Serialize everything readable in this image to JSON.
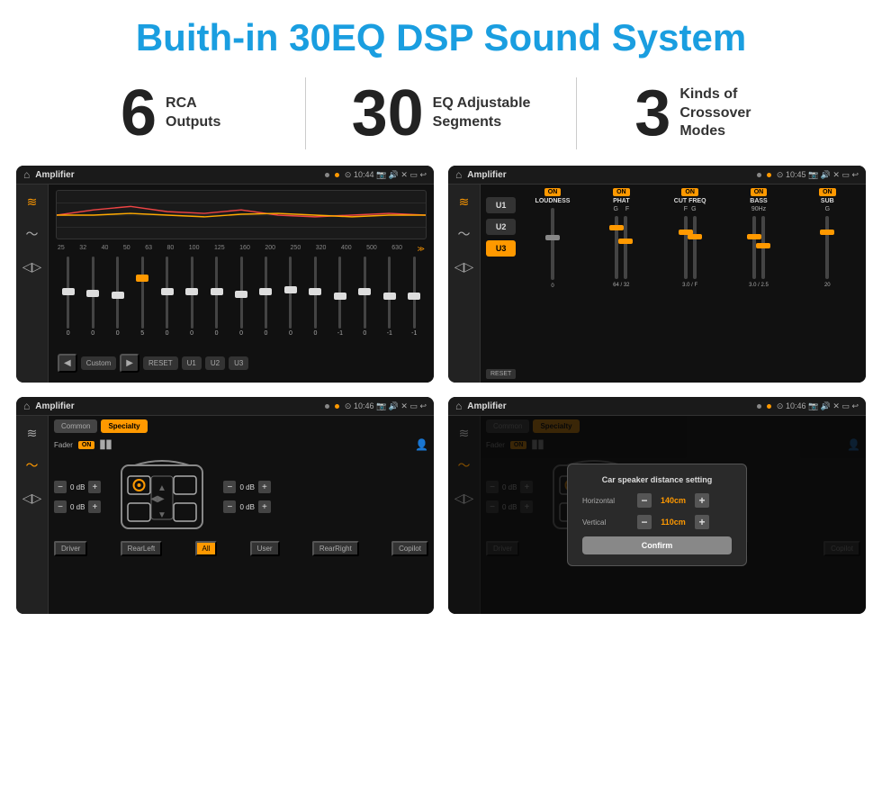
{
  "header": {
    "title": "Buith-in 30EQ DSP Sound System"
  },
  "stats": [
    {
      "number": "6",
      "label": "RCA\nOutputs"
    },
    {
      "number": "30",
      "label": "EQ Adjustable\nSegments"
    },
    {
      "number": "3",
      "label": "Kinds of\nCrossover Modes"
    }
  ],
  "screens": [
    {
      "id": "eq-screen",
      "statusBar": {
        "appTitle": "Amplifier",
        "time": "10:44"
      },
      "type": "eq"
    },
    {
      "id": "crossover-screen",
      "statusBar": {
        "appTitle": "Amplifier",
        "time": "10:45"
      },
      "type": "crossover"
    },
    {
      "id": "specialty-screen",
      "statusBar": {
        "appTitle": "Amplifier",
        "time": "10:46"
      },
      "type": "specialty"
    },
    {
      "id": "distance-screen",
      "statusBar": {
        "appTitle": "Amplifier",
        "time": "10:46"
      },
      "type": "distance-dialog"
    }
  ],
  "eq": {
    "frequencies": [
      "25",
      "32",
      "40",
      "50",
      "63",
      "80",
      "100",
      "125",
      "160",
      "200",
      "250",
      "320",
      "400",
      "500",
      "630"
    ],
    "sliderPositions": [
      50,
      48,
      45,
      50,
      52,
      55,
      48,
      46,
      50,
      52,
      53,
      50,
      49,
      47,
      47
    ],
    "values": [
      "0",
      "0",
      "0",
      "5",
      "0",
      "0",
      "0",
      "0",
      "0",
      "0",
      "0",
      "-1",
      "0",
      "-1",
      ""
    ],
    "bottomButtons": [
      "◀",
      "Custom",
      "▶",
      "RESET",
      "U1",
      "U2",
      "U3"
    ]
  },
  "crossover": {
    "uButtons": [
      "U1",
      "U2",
      "U3"
    ],
    "activeU": "U3",
    "controls": [
      {
        "label": "LOUDNESS",
        "on": true,
        "value": "0",
        "unit": ""
      },
      {
        "label": "PHAT",
        "on": true,
        "value": "64",
        "freqLabel": "G",
        "freq2": "F"
      },
      {
        "label": "CUT FREQ",
        "on": true,
        "value": "3.0",
        "freqLabel": "F",
        "freq2": "G"
      },
      {
        "label": "BASS",
        "on": true,
        "value": "3.0",
        "freqLabel": "",
        "freq2": ""
      },
      {
        "label": "SUB",
        "on": true,
        "value": "20",
        "freqLabel": "G",
        "freq2": ""
      }
    ]
  },
  "specialty": {
    "tabs": [
      "Common",
      "Specialty"
    ],
    "activeTab": "Specialty",
    "fader": {
      "label": "Fader",
      "on": true
    },
    "dbControls": [
      {
        "value": "0 dB",
        "pos": "tl"
      },
      {
        "value": "0 dB",
        "pos": "tr"
      },
      {
        "value": "0 dB",
        "pos": "bl"
      },
      {
        "value": "0 dB",
        "pos": "br"
      }
    ],
    "bottomLabels": [
      "Driver",
      "RearLeft",
      "All",
      "User",
      "RearRight",
      "Copilot"
    ]
  },
  "dialog": {
    "title": "Car speaker distance setting",
    "rows": [
      {
        "label": "Horizontal",
        "value": "140cm"
      },
      {
        "label": "Vertical",
        "value": "110cm"
      }
    ],
    "confirmLabel": "Confirm"
  }
}
